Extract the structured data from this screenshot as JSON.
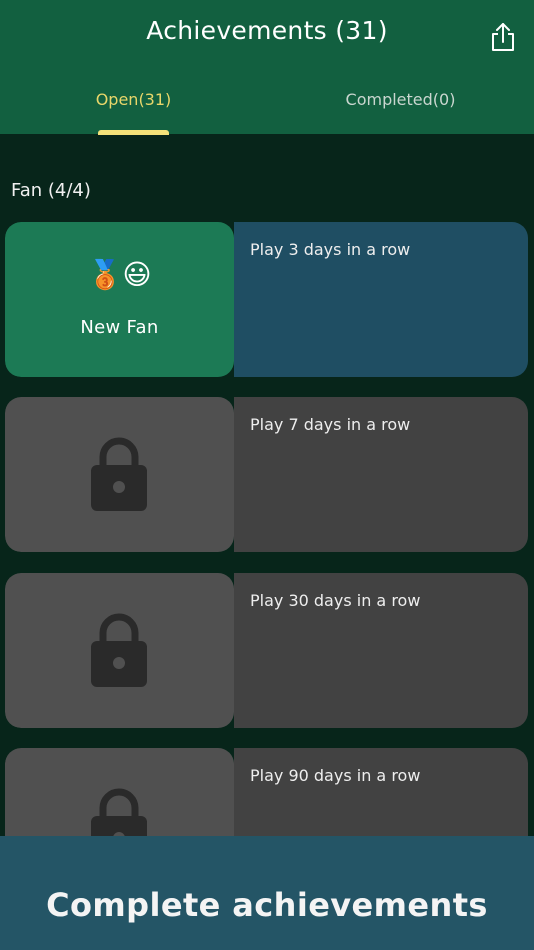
{
  "header": {
    "title": "Achievements (31)",
    "share_icon": "share-icon",
    "tabs": [
      {
        "label": "Open(31)",
        "active": true
      },
      {
        "label": "Completed(0)",
        "active": false
      }
    ]
  },
  "section": {
    "title": "Fan (4/4)"
  },
  "cards": [
    {
      "name": "New Fan",
      "badge": "🥉",
      "emoji": "😃",
      "description": "Play 3 days in a row",
      "locked": false
    },
    {
      "description": "Play 7 days in a row",
      "locked": true,
      "icon": "lock-icon"
    },
    {
      "description": "Play 30 days in a row",
      "locked": true,
      "icon": "lock-icon"
    },
    {
      "description": "Play 90 days in a row",
      "locked": true,
      "icon": "lock-icon"
    }
  ],
  "footer": {
    "text": "Complete achievements"
  },
  "colors": {
    "header_bg": "#126040",
    "page_bg": "#07251a",
    "active_tab": "#e8d66a",
    "unlocked_left": "#1c7a55",
    "unlocked_right": "#1f4e63",
    "locked_left": "#505050",
    "locked_right": "#424242",
    "footer_bg": "#245566"
  }
}
